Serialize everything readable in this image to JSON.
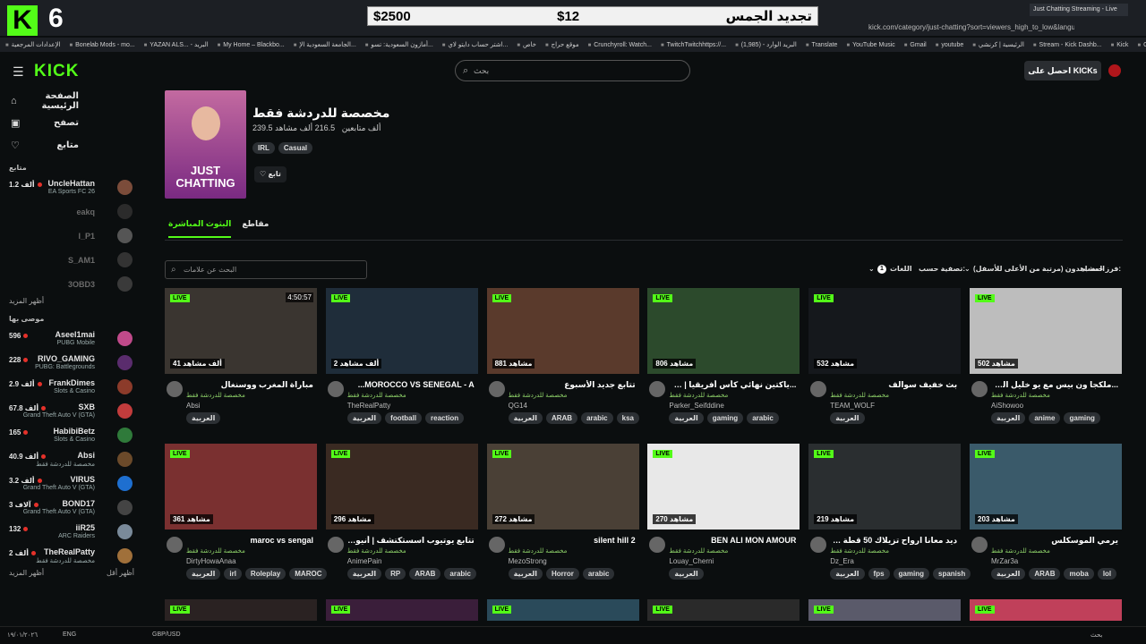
{
  "browser": {
    "badge_letter": "K",
    "channel_number": "6",
    "ad": {
      "left_price": "$2500",
      "middle_price": "$12",
      "right_text": "تجديد الجمس"
    },
    "tab_title": "Just Chatting Streaming - Live",
    "address": "kick.com/category/just-chatting?sort=viewers_high_to_low&languages=ar",
    "bookmarks": [
      "الإعدادات المرجعية",
      "Bonelab Mods - mo...",
      "YAZAN ALS... - البريد",
      "My Home – Blackbo...",
      "الجامعة السعودية الإ...",
      "أمازون السعودية: تسو...",
      "اشتر حساب دايتو لاي...",
      "خاص",
      "موقع حراج",
      "Crunchyroll: Watch...",
      "TwitchTwitchhttps://...",
      "(1,985) - البريد الوارد",
      "Translate",
      "YouTube Music",
      "Gmail",
      "youtube",
      "الرئيسية | كرنشي",
      "Stream - Kick Dashb...",
      "Kick",
      "Google"
    ]
  },
  "nav": {
    "logo": "KICK",
    "search_placeholder": "بحث",
    "get_kicks": "احصل على KICKs"
  },
  "sidebar": {
    "main": [
      {
        "label": "الصفحة الرئيسية",
        "icon": "home-icon"
      },
      {
        "label": "تصفح",
        "icon": "browse-icon"
      },
      {
        "label": "متابع",
        "icon": "heart-icon"
      }
    ],
    "following_title": "متابع",
    "following": [
      {
        "name": "UncleHattan",
        "count": "1.2 ألف",
        "game": "EA Sports FC 26",
        "online": true,
        "avatar": "#7b4c3a"
      },
      {
        "name": "eakq",
        "online": false,
        "avatar": "#2b2b2b"
      },
      {
        "name": "I_P1",
        "online": false,
        "avatar": "#555"
      },
      {
        "name": "S_AM1",
        "online": false,
        "avatar": "#333"
      },
      {
        "name": "3OBD3",
        "online": false,
        "avatar": "#3a3a3a"
      }
    ],
    "more_label": "أظهر المزيد",
    "recommended_title": "موصى بها",
    "recommended": [
      {
        "name": "Aseel1mai",
        "count": "596",
        "game": "PUBG Mobile",
        "avatar": "#c04a8a"
      },
      {
        "name": "RIVO_GAMING",
        "count": "228",
        "game": "PUBG: Battlegrounds",
        "avatar": "#5a2c6d"
      },
      {
        "name": "FrankDimes",
        "count": "2.9 ألف",
        "game": "Slots & Casino",
        "avatar": "#8c3b2a"
      },
      {
        "name": "SXB",
        "count": "67.8 ألف",
        "game": "Grand Theft Auto V (GTA)",
        "avatar": "#c23c3c"
      },
      {
        "name": "HabibiBetz",
        "count": "165",
        "game": "Slots & Casino",
        "avatar": "#2f7a3a"
      },
      {
        "name": "Absi",
        "count": "40.9 ألف",
        "game": "مخصصة للدردشة فقط",
        "avatar": "#6b4a2a"
      },
      {
        "name": "VIRUS",
        "count": "3.2 ألف",
        "game": "Grand Theft Auto V (GTA)",
        "avatar": "#1e6fd0"
      },
      {
        "name": "BOND17",
        "count": "3 آلاف",
        "game": "Grand Theft Auto V (GTA)",
        "avatar": "#444"
      },
      {
        "name": "iiR25",
        "count": "132",
        "game": "ARC Raiders",
        "avatar": "#7a8a9a"
      },
      {
        "name": "TheRealPatty",
        "count": "2 ألف",
        "game": "مخصصة للدردشة فقط",
        "avatar": "#a0703a"
      }
    ],
    "more_label2": "أظهر المزيد",
    "less_label": "أظهر أقل"
  },
  "category": {
    "title": "مخصصة للدردشة فقط",
    "viewers": "216.5 ألف مشاهد",
    "followers": "239.5 ألف متابعين",
    "tags": [
      "IRL",
      "Casual"
    ],
    "cover_text": "JUST CHATTING",
    "follow_label": "تابع"
  },
  "tabs": [
    {
      "label": "البثوث المباشرة",
      "active": true
    },
    {
      "label": "مقاطع",
      "active": false
    }
  ],
  "tag_search_placeholder": "البحث عن علامات",
  "filters": {
    "sort_label": "فرز حسب:",
    "sort_value": "المشاهدون (مرتبة من الأعلى للأسفل)",
    "filter_label": "تصفية حسب:",
    "languages_label": "اللغات",
    "languages_count": "1"
  },
  "streams": [
    {
      "title": "مباراة المغرب ووسنغال",
      "channel": "Absi",
      "views": "41 ألف مشاهد",
      "tags": [
        "العربية"
      ],
      "thumb": "#3a3530",
      "duration": "4:50:57"
    },
    {
      "title": "MOROCCO VS SENEGAL - A...",
      "channel": "TheRealPatty",
      "views": "2 ألف مشاهد",
      "tags": [
        "العربية",
        "football",
        "reaction"
      ],
      "thumb": "#1f2d3a"
    },
    {
      "title": "تتابع جديد الأسبوع",
      "channel": "QG14",
      "views": "881 مشاهد",
      "tags": [
        "العربية",
        "ARAB",
        "arabic",
        "ksa"
      ],
      "thumb": "#5a3a2c"
    },
    {
      "title": "...ياكتين نهائي كأس أفريقيا | سهرية عالمية",
      "channel": "Parker_Seifddine",
      "views": "806 مشاهد",
      "tags": [
        "العربية",
        "gaming",
        "arabic"
      ],
      "thumb": "#2c4a2c"
    },
    {
      "title": "بث خفيف سوالف",
      "channel": "TEAM_WOLF",
      "views": "532 مشاهد",
      "tags": [
        "العربية"
      ],
      "thumb": "#15181c"
    },
    {
      "title": "...ملكجا ون بيس مع يو خليل المتشافل وماتع",
      "channel": "AiShowoo",
      "views": "502 مشاهد",
      "tags": [
        "العربية",
        "anime",
        "gaming"
      ],
      "thumb": "#bdbdbd"
    },
    {
      "title": "maroc vs sengal",
      "channel": "DirtyHowaAnaa",
      "views": "361 مشاهد",
      "tags": [
        "العربية",
        "irl",
        "Roleplay",
        "MAROC"
      ],
      "thumb": "#7a3030"
    },
    {
      "title": "تتابع يوتيوب اسستكتشف | أنيوتيوب",
      "channel": "AnimePain",
      "views": "296 مشاهد",
      "tags": [
        "العربية",
        "RP",
        "ARAB",
        "arabic"
      ],
      "thumb": "#3a2a22"
    },
    {
      "title": "silent hill 2",
      "channel": "MezoStrong",
      "views": "272 مشاهد",
      "tags": [
        "العربية",
        "Horror",
        "arabic"
      ],
      "thumb": "#4a4036"
    },
    {
      "title": "BEN ALI MON AMOUR",
      "channel": "Louay_Cherni",
      "views": "270 مشاهد",
      "tags": [
        "العربية"
      ],
      "thumb": "#e8e8e8"
    },
    {
      "title": "ديد معانا ارواح تزيلاك 50 قطة 🐱🐱...",
      "channel": "Dz_Era",
      "views": "219 مشاهد",
      "tags": [
        "العربية",
        "fps",
        "gaming",
        "spanish"
      ],
      "thumb": "#2a2e30"
    },
    {
      "title": "يرمي الموسكلس",
      "channel": "MrZar3a",
      "views": "203 مشاهد",
      "tags": [
        "العربية",
        "ARAB",
        "moba",
        "lol"
      ],
      "thumb": "#3a5a6a"
    },
    {
      "title": "",
      "channel": "",
      "views": "",
      "tags": [],
      "thumb": "#2a2222"
    },
    {
      "title": "",
      "channel": "",
      "views": "",
      "tags": [],
      "thumb": "#3a1e3a"
    },
    {
      "title": "",
      "channel": "",
      "views": "",
      "tags": [],
      "thumb": "#2a4a5a"
    },
    {
      "title": "",
      "channel": "",
      "views": "",
      "tags": [],
      "thumb": "#2a2a2a"
    },
    {
      "title": "",
      "channel": "",
      "views": "",
      "tags": [],
      "thumb": "#5a5a6a"
    },
    {
      "title": "",
      "channel": "",
      "views": "",
      "tags": [],
      "thumb": "#c0405a"
    }
  ],
  "live_label": "LIVE",
  "stream_category_label": "مخصصة للدردشة فقط",
  "taskbar": {
    "date": "١٩/٠١/٢٠٢٦",
    "lang": "ENG",
    "currency": "GBP/USD",
    "search": "بحث"
  },
  "colors": {
    "accent": "#53fc18",
    "background": "#0b0e0f",
    "live_dot": "#e5312a"
  }
}
